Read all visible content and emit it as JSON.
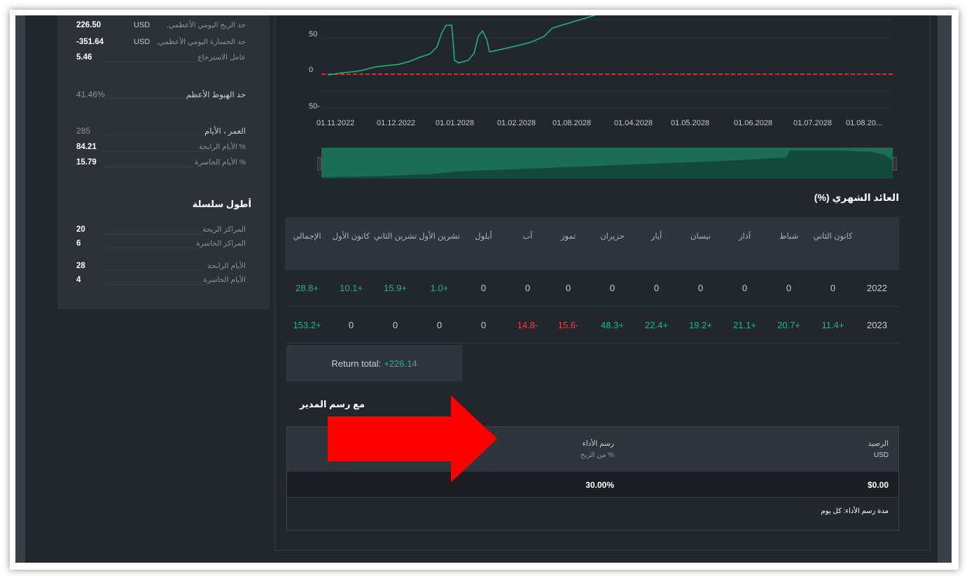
{
  "stats": {
    "rows": [
      {
        "value": "226.50",
        "currency": "USD",
        "label": "حد الربح اليومي الأعظمي,"
      },
      {
        "value": "-351.64",
        "currency": "USD",
        "label": "حد الخسارة اليومي الأعظمي,"
      },
      {
        "value": "5.46",
        "label": "عامل الاسترجاع"
      },
      {
        "value": "41.46%",
        "label": "حد الهبوط الأعظم"
      },
      {
        "value": "285",
        "label": "العمر ، الأيام"
      },
      {
        "value": "84.21",
        "label": "% الأيام الرابحة"
      },
      {
        "value": "15.79",
        "label": "% الأيام الخاسرة"
      }
    ],
    "longest_title": "أطول سلسلة",
    "longest_rows": [
      {
        "value": "20",
        "label": "المراكز الربحة"
      },
      {
        "value": "6",
        "label": "المراكز الخاسرة"
      },
      {
        "value": "28",
        "label": "الأيام الرابحة"
      },
      {
        "value": "4",
        "label": "الأيام الخاسرة"
      }
    ]
  },
  "chart": {
    "y_ticks": [
      "50",
      "0",
      "50-"
    ],
    "x_ticks": [
      "01.11.2022",
      "01.12.2022",
      "01.01.2028",
      "01.02.2028",
      "01.08.2028",
      "01.04.2028",
      "01.05.2028",
      "01.06.2028",
      "01.07.2028",
      "01.08.20..."
    ],
    "line_color": "#1fb87f",
    "baseline_color": "#e0283a"
  },
  "monthly": {
    "title": "العائد الشهري (%)",
    "headers": [
      "كانون الثاني",
      "شباط",
      "آذار",
      "نيسان",
      "أيار",
      "حزيران",
      "تموز",
      "آب",
      "أيلول",
      "تشرين الأول",
      "تشرين الثاني",
      "كانون الأول",
      "الإجمالي"
    ],
    "rows": [
      {
        "year": "2022",
        "values": [
          "0",
          "0",
          "0",
          "0",
          "0",
          "0",
          "0",
          "0",
          "0",
          "1.0+",
          "15.9+",
          "10.1+",
          "28.8+"
        ]
      },
      {
        "year": "2023",
        "values": [
          "11.4+",
          "20.7+",
          "21.1+",
          "19.2+",
          "22.4+",
          "48.3+",
          "15.6-",
          "14.8-",
          "0",
          "0",
          "0",
          "0",
          "153.2+"
        ]
      }
    ],
    "return_total_label": "Return total:",
    "return_total_value": "+226.14"
  },
  "fee": {
    "title": "مع رسم المدير",
    "balance_label": "الرصيد",
    "balance_sub": "USD",
    "balance_value": "$0.00",
    "perf_label": "رسم الأداء",
    "perf_sub": "% من الربح",
    "perf_value": "30.00%",
    "period_note": "مدة رسم الأداء: كل يوم"
  },
  "colors": {
    "positive": "#1fb87f",
    "negative": "#e8414f",
    "arrow": "#ff0000"
  }
}
